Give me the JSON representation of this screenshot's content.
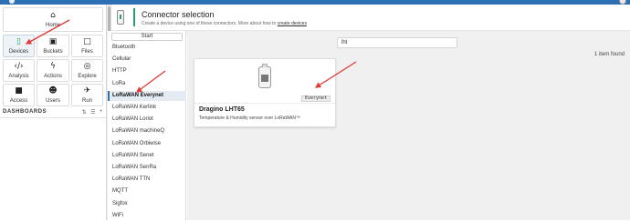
{
  "header": {
    "title": "Connector selection",
    "subtitle": "Create a device using one of these connectors. More about how to",
    "link": "create devices"
  },
  "nav": {
    "tiles": [
      {
        "id": "home",
        "label": "Home",
        "icon": "home-icon",
        "glyph": "⌂"
      },
      {
        "id": "devices",
        "label": "Devices",
        "icon": "devices-icon",
        "glyph": "▯"
      },
      {
        "id": "buckets",
        "label": "Buckets",
        "icon": "buckets-icon",
        "glyph": "▣"
      },
      {
        "id": "files",
        "label": "Files",
        "icon": "files-icon",
        "glyph": "□"
      },
      {
        "id": "analysis",
        "label": "Analysis",
        "icon": "analysis-icon",
        "glyph": "‹/›"
      },
      {
        "id": "actions",
        "label": "Actions",
        "icon": "actions-icon",
        "glyph": "ϟ"
      },
      {
        "id": "explore",
        "label": "Explore",
        "icon": "explore-icon",
        "glyph": "◎"
      },
      {
        "id": "access",
        "label": "Access",
        "icon": "lock-icon",
        "glyph": "■"
      },
      {
        "id": "users",
        "label": "Users",
        "icon": "users-icon",
        "glyph": "☻"
      },
      {
        "id": "run",
        "label": "Run",
        "icon": "run-icon",
        "glyph": "✈"
      }
    ],
    "active": "devices",
    "dashboards_label": "DASHBOARDS",
    "dash_tools": [
      "⇅",
      "☰",
      "+"
    ]
  },
  "connectors": {
    "start_label": "Start",
    "items": [
      "Bluetooth",
      "Cellular",
      "HTTP",
      "LoRa",
      "LoRaWAN Everynet",
      "LoRaWAN Kerlink",
      "LoRaWAN Loriot",
      "LoRaWAN machineQ",
      "LoRaWAN Orbiwise",
      "LoRaWAN Senet",
      "LoRaWAN SenRa",
      "LoRaWAN TTN",
      "MQTT",
      "Sigfox",
      "WiFi"
    ],
    "selected_index": 4
  },
  "main": {
    "search_value": "lht",
    "count_text": "1 item found",
    "card": {
      "name": "Dragino LHT65",
      "description": "Temperature & Humidity sensor over LoRaWAN™",
      "badge": "Everynet"
    }
  },
  "colors": {
    "topbar": "#2d6fb4",
    "accent": "#2a9b6e",
    "arrow": "#e53935"
  }
}
